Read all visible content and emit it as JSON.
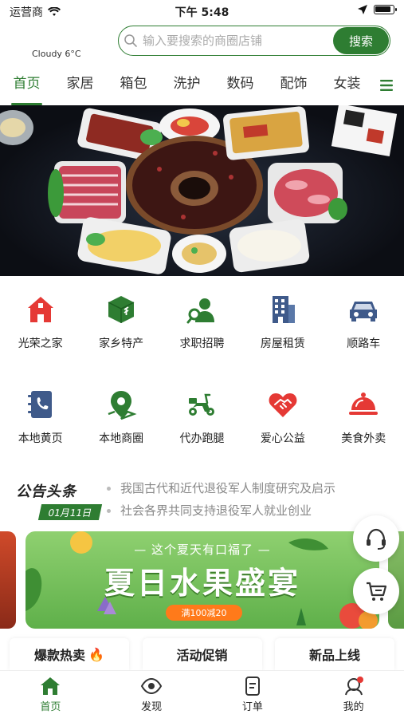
{
  "status_bar": {
    "carrier": "运营商",
    "time": "下午 5:48"
  },
  "header": {
    "weather": "Cloudy 6°C",
    "search_placeholder": "输入要搜索的商圈店铺",
    "search_button": "搜索"
  },
  "categories": [
    {
      "label": "首页",
      "active": true
    },
    {
      "label": "家居"
    },
    {
      "label": "箱包"
    },
    {
      "label": "洗护"
    },
    {
      "label": "数码"
    },
    {
      "label": "配饰"
    },
    {
      "label": "女装"
    }
  ],
  "services_row1": [
    {
      "label": "光荣之家",
      "icon": "home-icon",
      "color": "#e53935"
    },
    {
      "label": "家乡特产",
      "icon": "package-icon",
      "color": "#2e7d32"
    },
    {
      "label": "求职招聘",
      "icon": "job-search-icon",
      "color": "#2e7d32"
    },
    {
      "label": "房屋租赁",
      "icon": "building-icon",
      "color": "#3f5a8a"
    },
    {
      "label": "顺路车",
      "icon": "car-icon",
      "color": "#3f5a8a"
    }
  ],
  "services_row2": [
    {
      "label": "本地黄页",
      "icon": "contacts-book-icon",
      "color": "#3f5a8a"
    },
    {
      "label": "本地商圈",
      "icon": "map-pin-icon",
      "color": "#2e7d32"
    },
    {
      "label": "代办跑腿",
      "icon": "scooter-icon",
      "color": "#2e7d32"
    },
    {
      "label": "爱心公益",
      "icon": "heart-handshake-icon",
      "color": "#e53935"
    },
    {
      "label": "美食外卖",
      "icon": "food-cloche-icon",
      "color": "#e53935"
    }
  ],
  "notice": {
    "title": "公告头条",
    "date": "01月11日",
    "items": [
      "我国古代和近代退役军人制度研究及启示",
      "社会各界共同支持退役军人就业创业"
    ]
  },
  "promo": {
    "subtitle": "— 这个夏天有口福了 —",
    "title": "夏日水果盛宴",
    "tag": "满100减20"
  },
  "sections": [
    {
      "label": "爆款热卖",
      "emoji": "🔥"
    },
    {
      "label": "活动促销"
    },
    {
      "label": "新品上线"
    }
  ],
  "bottom_nav": [
    {
      "label": "首页",
      "icon": "home-icon",
      "active": true
    },
    {
      "label": "发现",
      "icon": "eye-icon"
    },
    {
      "label": "订单",
      "icon": "order-icon"
    },
    {
      "label": "我的",
      "icon": "user-icon"
    }
  ],
  "colors": {
    "brand": "#2e7d32",
    "red": "#e53935",
    "navy": "#3f5a8a"
  }
}
